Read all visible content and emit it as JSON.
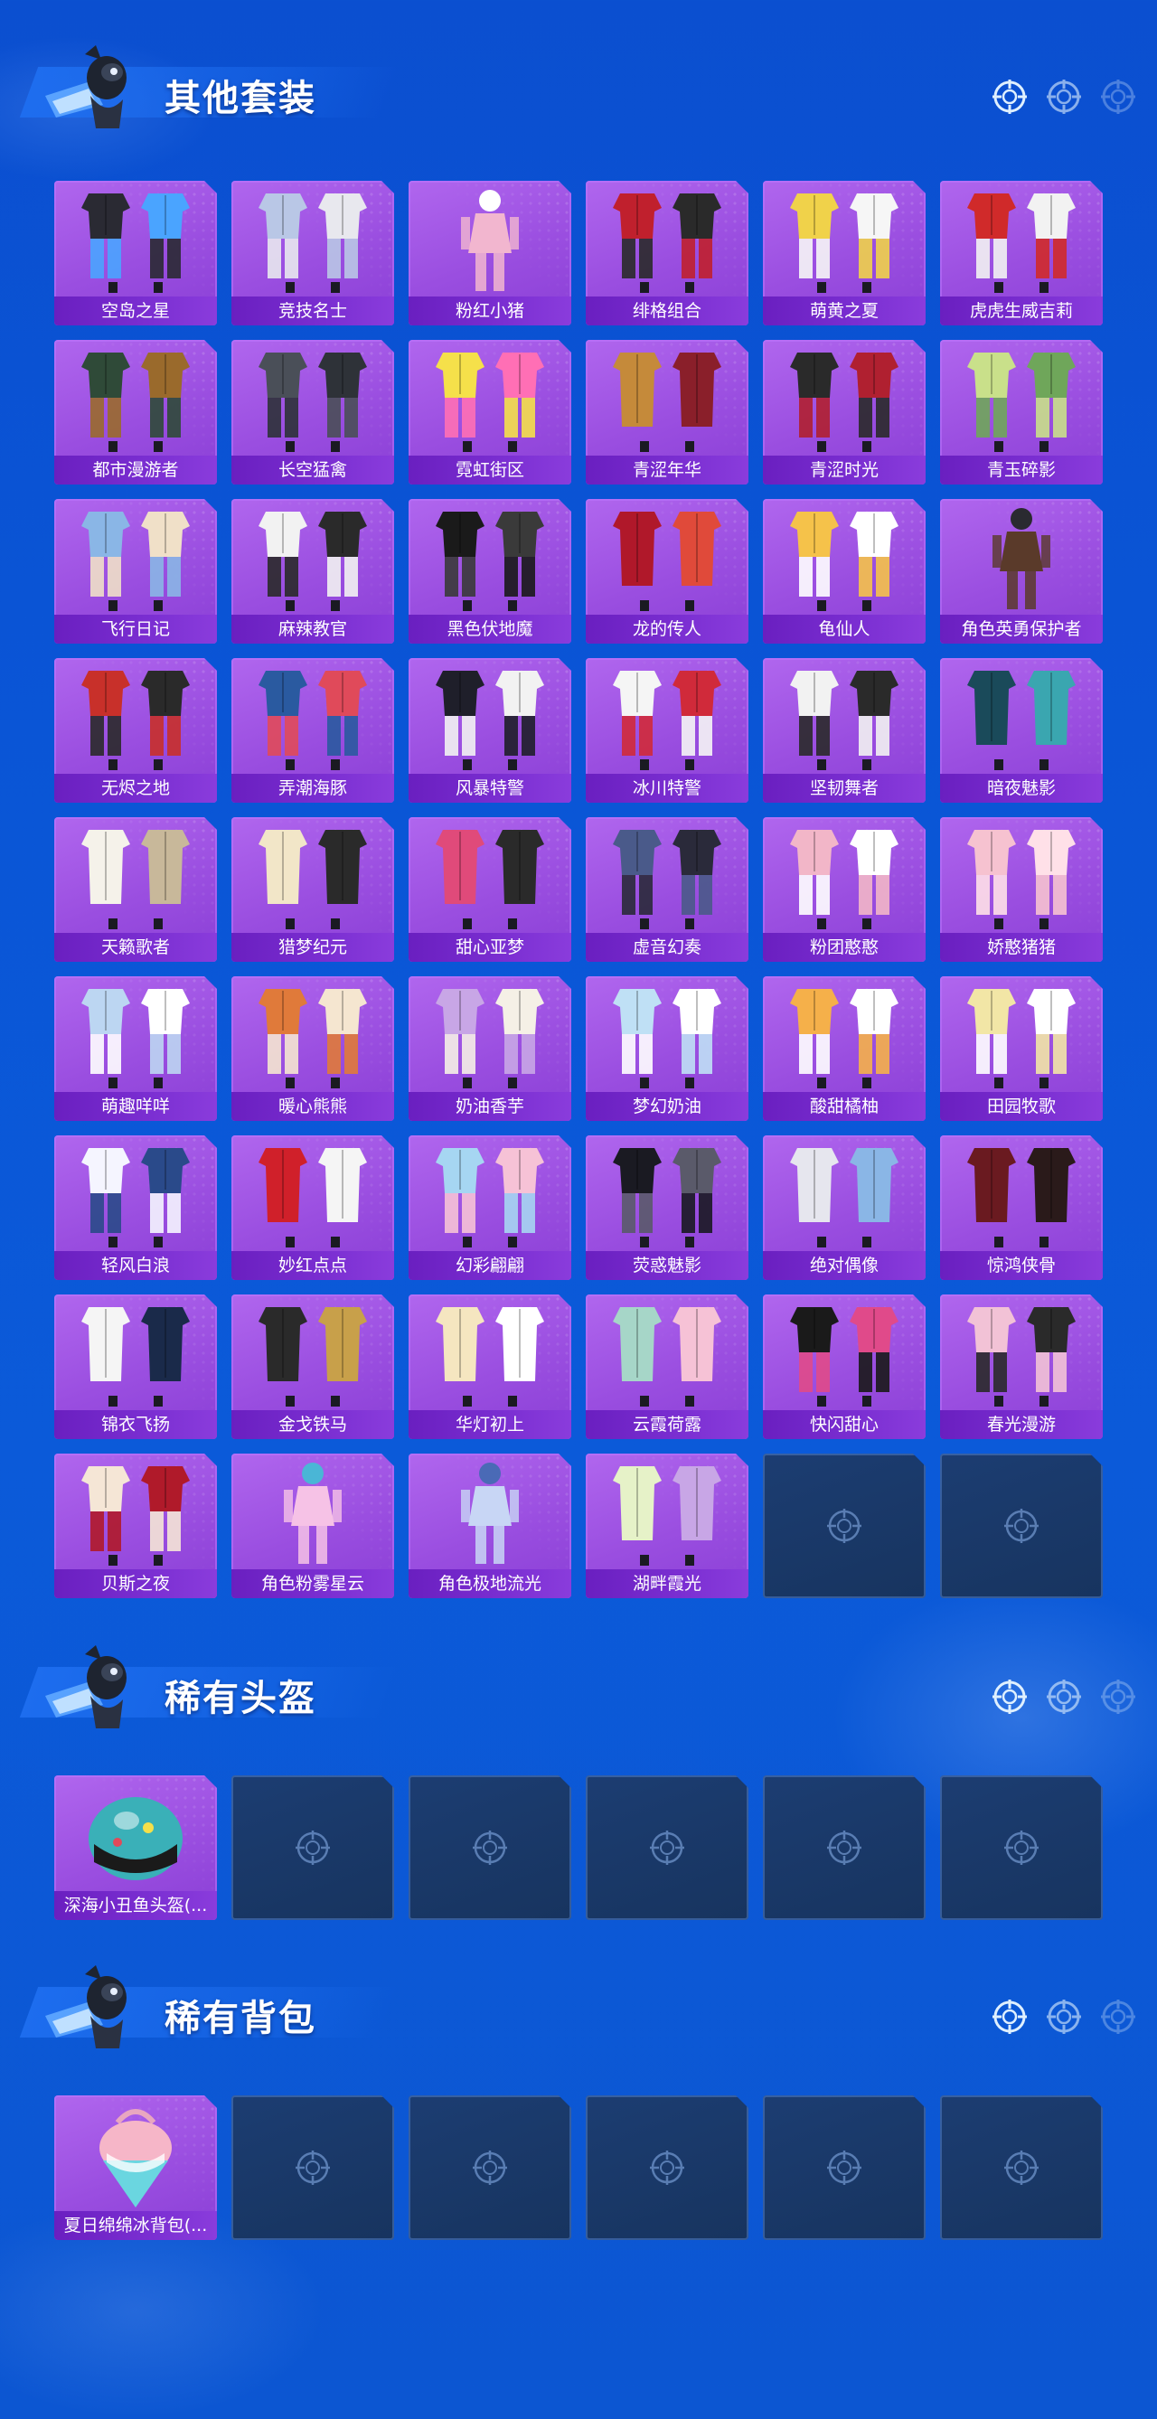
{
  "sections": [
    {
      "title": "其他套装",
      "items": [
        {
          "label": "空岛之星",
          "icon": "dark-outfit",
          "colors": [
            "#2a2a33",
            "#4aa4ff"
          ]
        },
        {
          "label": "竞技名士",
          "icon": "jacket-outfit",
          "colors": [
            "#b9c7e6",
            "#e8e8ee"
          ]
        },
        {
          "label": "粉红小猪",
          "icon": "figure-outfit",
          "colors": [
            "#f2b6cf",
            "#ffffff"
          ]
        },
        {
          "label": "绯格组合",
          "icon": "jacket-outfit",
          "colors": [
            "#c0202d",
            "#2a2a2a"
          ]
        },
        {
          "label": "萌黄之夏",
          "icon": "shirt-outfit",
          "colors": [
            "#f0d24a",
            "#f6f6f6"
          ]
        },
        {
          "label": "虎虎生威吉莉",
          "icon": "suit-outfit",
          "colors": [
            "#d02a2a",
            "#f2f2f2"
          ]
        },
        {
          "label": "都市漫游者",
          "icon": "jacket-outfit",
          "colors": [
            "#2f4a38",
            "#9a6a2c"
          ]
        },
        {
          "label": "长空猛禽",
          "icon": "jacket-outfit",
          "colors": [
            "#4a4f58",
            "#2e3238"
          ]
        },
        {
          "label": "霓虹街区",
          "icon": "shirt-outfit",
          "colors": [
            "#f5e04a",
            "#ff6fb5"
          ]
        },
        {
          "label": "青涩年华",
          "icon": "coat-outfit",
          "colors": [
            "#c58a3a",
            "#8a1f2a"
          ]
        },
        {
          "label": "青涩时光",
          "icon": "jacket-outfit",
          "colors": [
            "#2a2a2a",
            "#b02030"
          ]
        },
        {
          "label": "青玉碎影",
          "icon": "shirt-outfit",
          "colors": [
            "#c9e08a",
            "#6fa65a"
          ]
        },
        {
          "label": "飞行日记",
          "icon": "jacket-outfit",
          "colors": [
            "#8ab6e6",
            "#f0e0c8"
          ]
        },
        {
          "label": "麻辣教官",
          "icon": "jacket-outfit",
          "colors": [
            "#f2f2f2",
            "#2a2a2a"
          ]
        },
        {
          "label": "黑色伏地魔",
          "icon": "hoodie-outfit",
          "colors": [
            "#1a1a1a",
            "#3a3a3a"
          ]
        },
        {
          "label": "龙的传人",
          "icon": "dress-outfit",
          "colors": [
            "#b0182a",
            "#e04a3a"
          ]
        },
        {
          "label": "龟仙人",
          "icon": "shirt-outfit",
          "colors": [
            "#f5c24a",
            "#ffffff"
          ]
        },
        {
          "label": "角色英勇保护者",
          "icon": "armor-outfit",
          "colors": [
            "#5a3a2a",
            "#2a2a30"
          ]
        },
        {
          "label": "无烬之地",
          "icon": "jacket-outfit",
          "colors": [
            "#c8302a",
            "#2a2a2a"
          ]
        },
        {
          "label": "弄潮海豚",
          "icon": "jacket-outfit",
          "colors": [
            "#2a5aa0",
            "#e04a5a"
          ]
        },
        {
          "label": "风暴特警",
          "icon": "jacket-outfit",
          "colors": [
            "#1f1f2a",
            "#f2f2f2"
          ]
        },
        {
          "label": "冰川特警",
          "icon": "jacket-outfit",
          "colors": [
            "#f5f5f5",
            "#d02a3a"
          ]
        },
        {
          "label": "坚韧舞者",
          "icon": "jacket-outfit",
          "colors": [
            "#f2f2f2",
            "#2a2a2a"
          ]
        },
        {
          "label": "暗夜魅影",
          "icon": "dress-outfit",
          "colors": [
            "#1a4a5a",
            "#3aa6b0"
          ]
        },
        {
          "label": "天籁歌者",
          "icon": "coat-outfit",
          "colors": [
            "#f5f2ea",
            "#c8b89a"
          ]
        },
        {
          "label": "猎梦纪元",
          "icon": "dress-outfit",
          "colors": [
            "#f2e6c8",
            "#2a2a2a"
          ]
        },
        {
          "label": "甜心亚梦",
          "icon": "dress-outfit",
          "colors": [
            "#e04a7a",
            "#2a2a2a"
          ]
        },
        {
          "label": "虚音幻奏",
          "icon": "jacket-outfit",
          "colors": [
            "#4a5a8a",
            "#2a2a3a"
          ]
        },
        {
          "label": "粉团憨憨",
          "icon": "shirt-outfit",
          "colors": [
            "#f2b6c8",
            "#ffffff"
          ]
        },
        {
          "label": "娇憨猪猪",
          "icon": "shirt-outfit",
          "colors": [
            "#f6c2d0",
            "#ffe0e8"
          ]
        },
        {
          "label": "萌趣咩咩",
          "icon": "shirt-outfit",
          "colors": [
            "#bcd6f2",
            "#ffffff"
          ]
        },
        {
          "label": "暖心熊熊",
          "icon": "jacket-outfit",
          "colors": [
            "#e07a3a",
            "#f5e6d0"
          ]
        },
        {
          "label": "奶油香芋",
          "icon": "shirt-outfit",
          "colors": [
            "#c8a6e6",
            "#f5f0e6"
          ]
        },
        {
          "label": "梦幻奶油",
          "icon": "shirt-outfit",
          "colors": [
            "#bfe0f5",
            "#ffffff"
          ]
        },
        {
          "label": "酸甜橘柚",
          "icon": "shirt-outfit",
          "colors": [
            "#f5b04a",
            "#ffffff"
          ]
        },
        {
          "label": "田园牧歌",
          "icon": "shirt-outfit",
          "colors": [
            "#f2e6a6",
            "#ffffff"
          ]
        },
        {
          "label": "轻风白浪",
          "icon": "shirt-outfit",
          "colors": [
            "#f5f5ff",
            "#2a4a8a"
          ]
        },
        {
          "label": "妙红点点",
          "icon": "dress-outfit",
          "colors": [
            "#d0202a",
            "#f5f5f5"
          ]
        },
        {
          "label": "幻彩翩翩",
          "icon": "shirt-outfit",
          "colors": [
            "#a6d6f2",
            "#f6c2d6"
          ]
        },
        {
          "label": "荧惑魅影",
          "icon": "jacket-outfit",
          "colors": [
            "#1a1a22",
            "#5a5a6a"
          ]
        },
        {
          "label": "绝对偶像",
          "icon": "dress-outfit",
          "colors": [
            "#e6e6ee",
            "#8ab6e6"
          ]
        },
        {
          "label": "惊鸿侠骨",
          "icon": "coat-outfit",
          "colors": [
            "#6a1a20",
            "#2a1a1a"
          ]
        },
        {
          "label": "锦衣飞扬",
          "icon": "coat-outfit",
          "colors": [
            "#f5f5f5",
            "#1a2a4a"
          ]
        },
        {
          "label": "金戈铁马",
          "icon": "coat-outfit",
          "colors": [
            "#2a2a2a",
            "#c8a04a"
          ]
        },
        {
          "label": "华灯初上",
          "icon": "dress-outfit",
          "colors": [
            "#f5e6c0",
            "#ffffff"
          ]
        },
        {
          "label": "云霞荷露",
          "icon": "dress-outfit",
          "colors": [
            "#a6d6c8",
            "#f6c2d6"
          ]
        },
        {
          "label": "快闪甜心",
          "icon": "jacket-outfit",
          "colors": [
            "#1a1a1a",
            "#e04a8a"
          ]
        },
        {
          "label": "春光漫游",
          "icon": "jacket-outfit",
          "colors": [
            "#f2c2d6",
            "#2a2a2a"
          ]
        },
        {
          "label": "贝斯之夜",
          "icon": "jacket-outfit",
          "colors": [
            "#f5e6d6",
            "#b01a2a"
          ]
        },
        {
          "label": "角色粉雾星云",
          "icon": "figure-outfit",
          "colors": [
            "#f6c2e6",
            "#4ab6d6"
          ]
        },
        {
          "label": "角色极地流光",
          "icon": "figure-outfit",
          "colors": [
            "#c8d6f5",
            "#4a6ab6"
          ]
        },
        {
          "label": "湖畔霞光",
          "icon": "dress-outfit",
          "colors": [
            "#e6f2c8",
            "#c8a6e6"
          ]
        },
        {
          "label": "",
          "icon": "empty-slot",
          "colors": []
        },
        {
          "label": "",
          "icon": "empty-slot",
          "colors": []
        }
      ]
    },
    {
      "title": "稀有头盔",
      "items": [
        {
          "label": "深海小丑鱼头盔(...",
          "icon": "helmet",
          "colors": [
            "#3ab0b8",
            "#1a1a1a"
          ]
        },
        {
          "label": "",
          "icon": "empty-slot",
          "colors": []
        },
        {
          "label": "",
          "icon": "empty-slot",
          "colors": []
        },
        {
          "label": "",
          "icon": "empty-slot",
          "colors": []
        },
        {
          "label": "",
          "icon": "empty-slot",
          "colors": []
        },
        {
          "label": "",
          "icon": "empty-slot",
          "colors": []
        }
      ]
    },
    {
      "title": "稀有背包",
      "items": [
        {
          "label": "夏日绵绵冰背包(...",
          "icon": "backpack",
          "colors": [
            "#f6b6c8",
            "#6ad6e0"
          ]
        },
        {
          "label": "",
          "icon": "empty-slot",
          "colors": []
        },
        {
          "label": "",
          "icon": "empty-slot",
          "colors": []
        },
        {
          "label": "",
          "icon": "empty-slot",
          "colors": []
        },
        {
          "label": "",
          "icon": "empty-slot",
          "colors": []
        },
        {
          "label": "",
          "icon": "empty-slot",
          "colors": []
        }
      ]
    }
  ]
}
